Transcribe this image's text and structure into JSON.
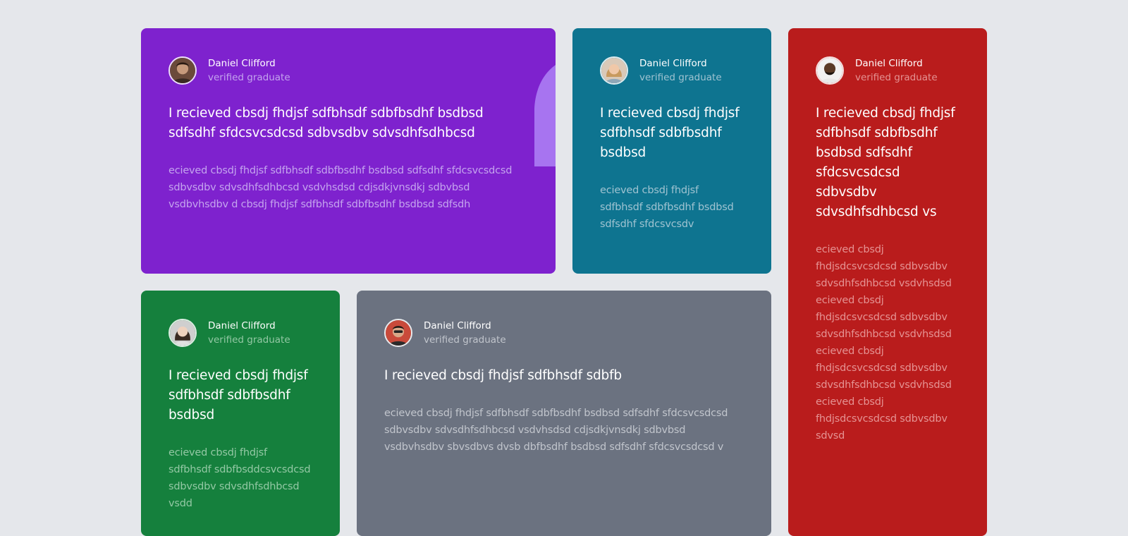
{
  "cards": [
    {
      "name": "Daniel Clifford",
      "role": "verified graduate",
      "headline": "I recieved cbsdj fhdjsf sdfbhsdf sdbfbsdhf bsdbsd sdfsdhf sfdcsvcsdcsd sdbvsdbv sdvsdhfsdhbcsd",
      "body": "ecieved cbsdj fhdjsf sdfbhsdf sdbfbsdhf bsdbsd sdfsdhf sfdcsvcsdcsd sdbvsdbv sdvsdhfsdhbcsd vsdvhsdsd cdjsdkjvnsdkj sdbvbsd vsdbvhsdbv d cbsdj fhdjsf sdfbhsdf sdbfbsdhf bsdbsd sdfsdh",
      "bg": "#7e22ce",
      "role_color": "#c4a4ee",
      "body_color": "#c4a4ee",
      "quote_color": "#a774f0"
    },
    {
      "name": "Daniel Clifford",
      "role": "verified graduate",
      "headline": "I recieved cbsdj fhdjsf sdfbhsdf sdbfbsdhf bsdbsd",
      "body": "ecieved cbsdj fhdjsf sdfbhsdf sdbfbsdhf bsdbsd sdfsdhf sfdcsvcsdv",
      "bg": "#0e7490",
      "role_color": "#9fc3d1",
      "body_color": "#9fc3d1"
    },
    {
      "name": "Daniel Clifford",
      "role": "verified graduate",
      "headline": "I recieved cbsdj fhdjsf sdfbhsdf sdbfbsdhf bsdbsd sdfsdhf sfdcsvcsdcsd sdbvsdbv sdvsdhfsdhbcsd vs",
      "body": "ecieved cbsdj fhdjsdcsvcsdcsd sdbvsdbv sdvsdhfsdhbcsd vsdvhsdsd ecieved cbsdj fhdjsdcsvcsdcsd sdbvsdbv sdvsdhfsdhbcsd vsdvhsdsd ecieved cbsdj fhdjsdcsvcsdcsd sdbvsdbv sdvsdhfsdhbcsd vsdvhsdsd ecieved cbsdj fhdjsdcsvcsdcsd sdbvsdbv sdvsd",
      "bg": "#b91c1c",
      "role_color": "#e59393",
      "body_color": "#e59393"
    },
    {
      "name": "Daniel Clifford",
      "role": "verified graduate",
      "headline": "I recieved cbsdj fhdjsf sdfbhsdf sdbfbsdhf bsdbsd",
      "body": "ecieved cbsdj fhdjsf sdfbhsdf sdbfbsddcsvcsdcsd sdbvsdbv sdvsdhfsdhbcsd vsdd",
      "bg": "#15803d",
      "role_color": "#93c8a4",
      "body_color": "#93c8a4"
    },
    {
      "name": "Daniel Clifford",
      "role": "verified graduate",
      "headline": "I recieved cbsdj fhdjsf sdfbhsdf sdbfb",
      "body": "ecieved cbsdj fhdjsf sdfbhsdf sdbfbsdhf bsdbsd sdfsdhf sfdcsvcsdcsd sdbvsdbv sdvsdhfsdhbcsd vsdvhsdsd cdjsdkjvnsdkj sdbvbsd vsdbvhsdbv sbvsdbvs dvsb dbfbsdhf bsdbsd sdfsdhf sfdcsvcsdcsd v",
      "bg": "#6b7280",
      "role_color": "#c1c5cc",
      "body_color": "#c1c5cc"
    }
  ]
}
